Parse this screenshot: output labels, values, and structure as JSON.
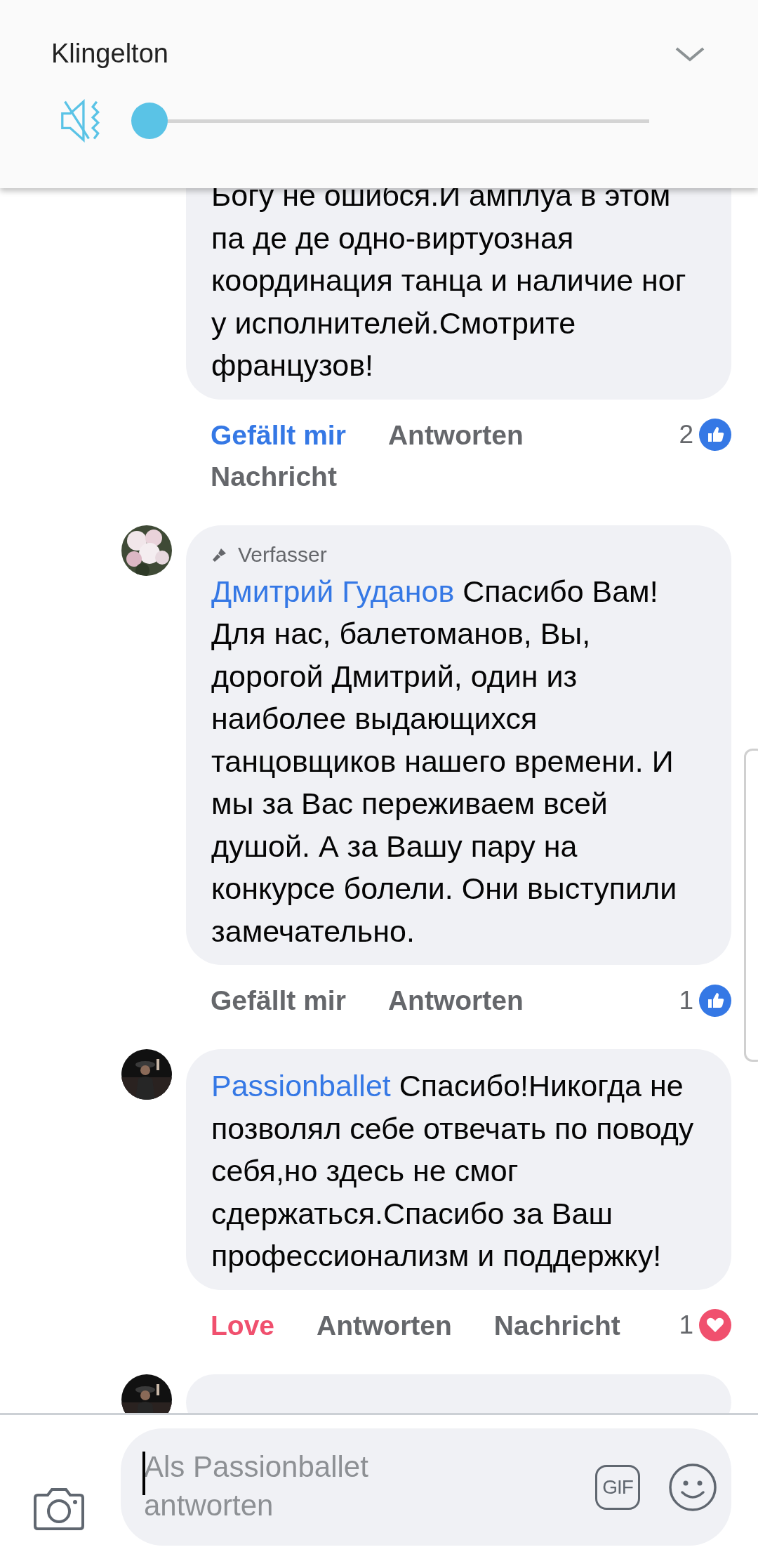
{
  "volume_panel": {
    "title": "Klingelton",
    "muted": true,
    "level": 0
  },
  "comments": [
    {
      "text": "Богу не ошибся.И амплуа в этом па де де одно-виртуозная координация танца и наличие ног у исполнителей.Смотрите французов!",
      "reaction": {
        "label": "Gefällt mir",
        "kind": "like",
        "selected": true
      },
      "actions": [
        "Antworten",
        "Nachricht"
      ],
      "count": {
        "text": "2",
        "kind": "like"
      }
    },
    {
      "avatar": {
        "kind": "picture"
      },
      "author_badge": "Verfasser",
      "author": "Дмитрий Гуданов",
      "text": "Спасибо Вам! Для нас,  балетоманов, Вы, дорогой Дмитрий, один из наиболее выдающихся танцовщиков нашего времени. И мы за Вас переживаем всей душой. А за Вашу пару на конкурсе болели. Они выступили замечательно.",
      "reaction": {
        "label": "Gefällt mir",
        "kind": "like",
        "selected": false
      },
      "actions": [
        "Antworten"
      ],
      "count": {
        "text": "1",
        "kind": "like"
      }
    },
    {
      "avatar": {
        "kind": "picture"
      },
      "author": "Passionballet",
      "text": "Спасибо!Никогда не позволял себе отвечать по поводу себя,но здесь не смог сдержаться.Спасибо за Ваш профессионализм и поддержку!",
      "reaction": {
        "label": "Love",
        "kind": "love",
        "selected": true
      },
      "actions": [
        "Antworten",
        "Nachricht"
      ],
      "count": {
        "text": "1",
        "kind": "love"
      }
    },
    {
      "avatar": {
        "kind": "picture"
      }
    }
  ],
  "composer": {
    "placeholder": "Als Passionballet antworten",
    "gif_label": "GIF"
  }
}
